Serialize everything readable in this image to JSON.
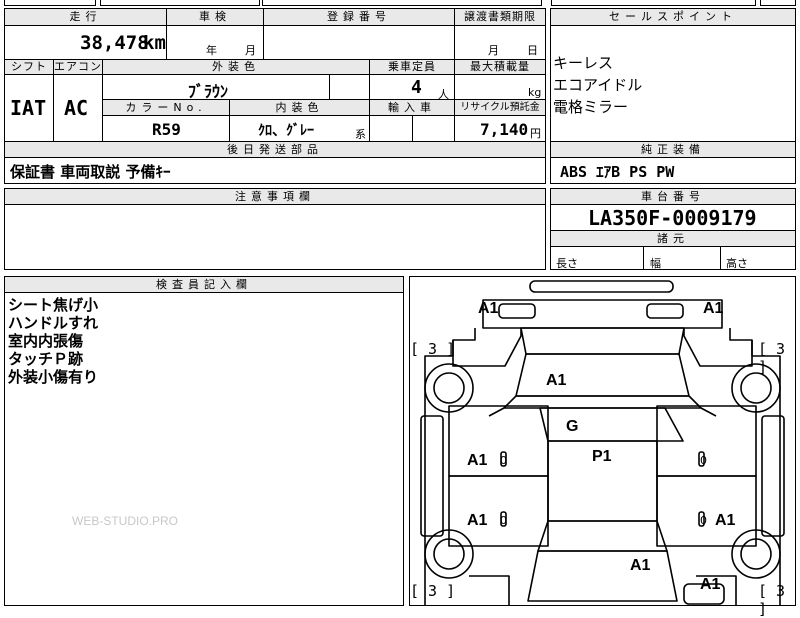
{
  "left_table": {
    "headers": {
      "mileage": "走行",
      "inspection": "車検",
      "registration": "登録番号",
      "transfer_deadline": "譲渡書類期限",
      "shift": "シフト",
      "ac": "エアコン",
      "exterior_color": "外装色",
      "capacity": "乗車定員",
      "max_load": "最大積載量",
      "color_no": "カラーNo.",
      "interior_color": "内装色",
      "import": "輸入車",
      "recycle": "リサイクル預託金",
      "accessories": "後日発送部品"
    },
    "values": {
      "mileage": "38,478",
      "mileage_unit": "km",
      "year": "年",
      "month": "月",
      "deadline_month": "月",
      "deadline_day": "日",
      "shift": "IAT",
      "ac": "AC",
      "exterior_color": "ﾌﾞﾗｳﾝ",
      "capacity": "4",
      "capacity_unit": "人",
      "max_load_unit": "kg",
      "color_no": "R59",
      "interior_color": "ｸﾛ、ｸﾞﾚｰ",
      "interior_suffix": "系",
      "recycle": "7,140",
      "recycle_unit": "円",
      "accessories": "保証書  車両取説  予備ｷｰ"
    }
  },
  "sales_points": {
    "header": "セールスポイント",
    "items": [
      "キーレス",
      "エコアイドル",
      "電格ミラー"
    ]
  },
  "equipment": {
    "header": "純正装備",
    "value": "ABS  ｴｱB  PS  PW"
  },
  "caution": {
    "header": "注意事項欄"
  },
  "chassis": {
    "header": "車台番号",
    "value": "LA350F-0009179",
    "dims_header": "諸元",
    "length": "長さ",
    "width": "幅",
    "height": "高さ"
  },
  "inspector": {
    "header": "検査員記入欄",
    "notes": [
      "シート焦げ小",
      "ハンドルすれ",
      "室内内張傷",
      "タッチＰ跡",
      "外装小傷有り"
    ]
  },
  "diagram": {
    "marks": {
      "front_left": "A1",
      "front_right": "A1",
      "hood": "A1",
      "roof_front": "G",
      "roof": "P1",
      "door_fl": "A1",
      "door_rl": "A1",
      "door_rr": "A1",
      "rear_center": "A1",
      "rear_right": "A1"
    },
    "tires": {
      "fl": "[ 3 ]",
      "fr": "[ 3 ]",
      "rl": "[ 3 ]",
      "rr": "[ 3 ]"
    },
    "small_num": "0"
  },
  "watermark": "WEB-STUDIO.PRO"
}
